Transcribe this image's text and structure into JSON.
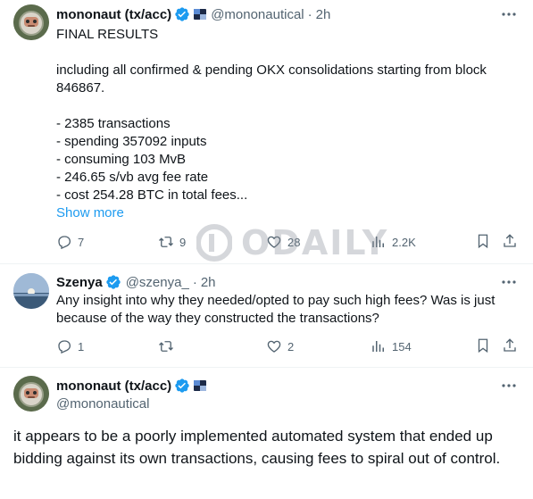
{
  "tweet1": {
    "name": "mononaut (tx/acc)",
    "handle": "@mononautical",
    "time": "2h",
    "text": "FINAL RESULTS\n\nincluding all confirmed & pending OKX consolidations starting from block 846867.\n\n- 2385 transactions\n- spending 357092 inputs\n- consuming 103 MvB\n- 246.65 s/vb avg fee rate\n- cost 254.28 BTC in total fees...",
    "show_more": "Show more",
    "replies": "7",
    "reposts": "9",
    "likes": "28",
    "views": "2.2K"
  },
  "tweet2": {
    "name": "Szenya",
    "handle": "@szenya_",
    "time": "2h",
    "text": "Any insight into why they needed/opted to pay such high fees? Was is just because of the way they constructed the transactions?",
    "replies": "1",
    "reposts": "",
    "likes": "2",
    "views": "154"
  },
  "tweet3": {
    "name": "mononaut (tx/acc)",
    "handle": "@mononautical",
    "text": "it appears to be a poorly implemented automated system that ended up bidding against its own transactions, causing fees to spiral out of control."
  },
  "watermark": "ODAILY",
  "dot": "·",
  "colors": {
    "accent": "#1d9bf0",
    "secondary": "#536471",
    "text": "#0f1419"
  }
}
